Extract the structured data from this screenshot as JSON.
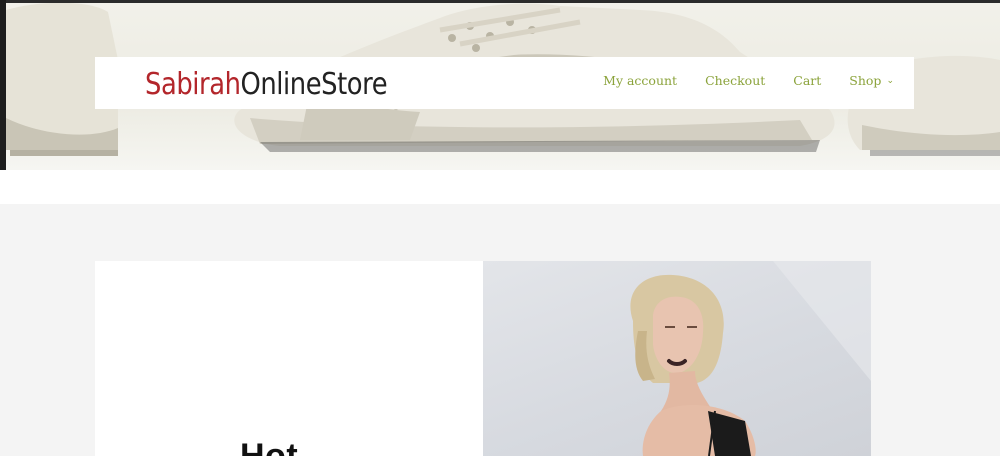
{
  "logo": {
    "part1": "Sabirah",
    "part2": "OnlineStore"
  },
  "nav": [
    {
      "label": "My account"
    },
    {
      "label": "Checkout"
    },
    {
      "label": "Cart"
    },
    {
      "label": "Shop",
      "has_dropdown": true
    }
  ],
  "promo": {
    "heading": "Hot"
  },
  "colors": {
    "brand_red": "#b3262b",
    "nav_green": "#8ba33b",
    "page_bg": "#f4f4f4"
  },
  "icons": {
    "shop_dropdown": "chevron-down-icon"
  }
}
